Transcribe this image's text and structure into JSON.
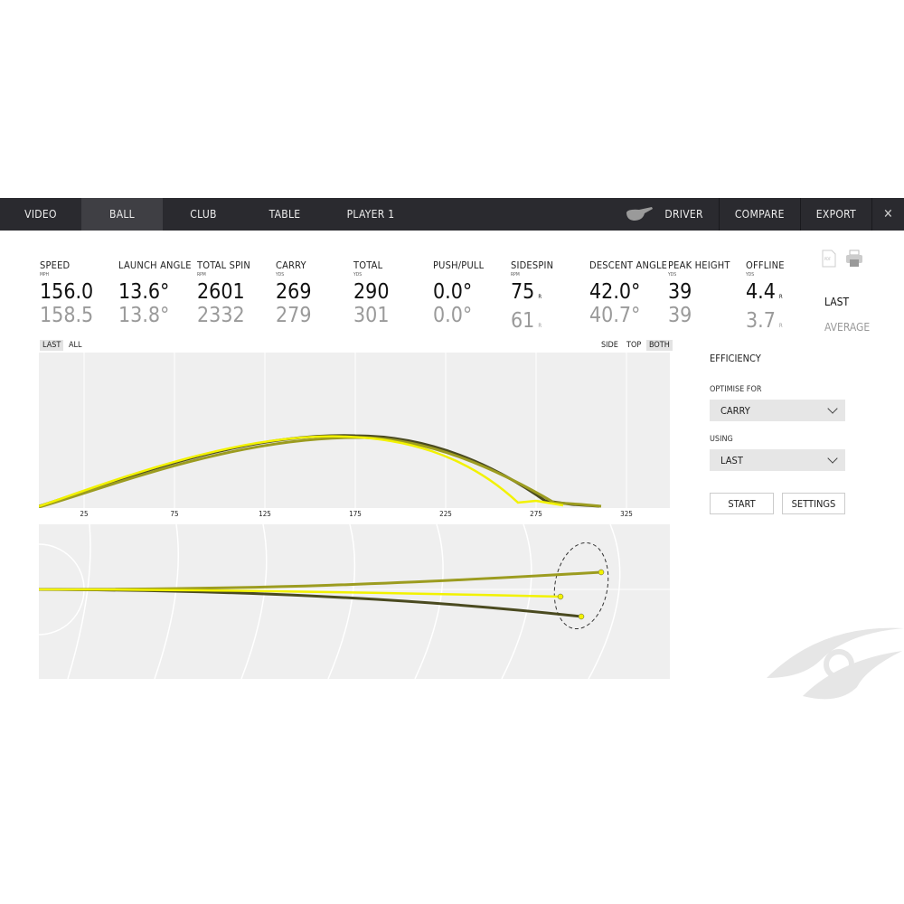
{
  "nav": {
    "tabs": [
      {
        "label": "VIDEO"
      },
      {
        "label": "BALL",
        "active": true
      },
      {
        "label": "CLUB"
      },
      {
        "label": "TABLE"
      },
      {
        "label": "PLAYER 1"
      }
    ],
    "right": {
      "club": "DRIVER",
      "compare": "COMPARE",
      "export": "EXPORT",
      "close": "✕"
    }
  },
  "stats": [
    {
      "label": "SPEED",
      "unit": "MPH",
      "last": "156.0",
      "avg": "158.5"
    },
    {
      "label": "LAUNCH ANGLE",
      "unit": "",
      "last": "13.6°",
      "avg": "13.8°"
    },
    {
      "label": "TOTAL SPIN",
      "unit": "RPM",
      "last": "2601",
      "avg": "2332"
    },
    {
      "label": "CARRY",
      "unit": "YDS",
      "last": "269",
      "avg": "279"
    },
    {
      "label": "TOTAL",
      "unit": "YDS",
      "last": "290",
      "avg": "301"
    },
    {
      "label": "PUSH/PULL",
      "unit": "",
      "last": "0.0°",
      "avg": "0.0°"
    },
    {
      "label": "SIDESPIN",
      "unit": "RPM",
      "last": "75",
      "avg": "61",
      "suffix": "R"
    },
    {
      "label": "DESCENT ANGLE",
      "unit": "",
      "last": "42.0°",
      "avg": "40.7°"
    },
    {
      "label": "PEAK HEIGHT",
      "unit": "YDS",
      "last": "39",
      "avg": "39"
    },
    {
      "label": "OFFLINE",
      "unit": "YDS",
      "last": "4.4",
      "avg": "3.7",
      "suffix": "R"
    }
  ],
  "row_labels": {
    "last": "LAST",
    "average": "AVERAGE"
  },
  "filter": {
    "last": "LAST",
    "all": "ALL"
  },
  "view": {
    "side": "SIDE",
    "top": "TOP",
    "both": "BOTH",
    "selected": "BOTH"
  },
  "side_chart": {
    "x_ticks": [
      "25",
      "75",
      "125",
      "175",
      "225",
      "275",
      "325"
    ]
  },
  "colors": {
    "shot_last": "#f2f200",
    "shot_mid": "#9c9c20",
    "shot_dark": "#4a4a20",
    "nav_bg": "#2a2a2f"
  },
  "efficiency": {
    "title": "EFFICIENCY",
    "optimise_label": "OPTIMISE FOR",
    "optimise_value": "CARRY",
    "using_label": "USING",
    "using_value": "LAST",
    "start": "START",
    "settings": "SETTINGS"
  }
}
